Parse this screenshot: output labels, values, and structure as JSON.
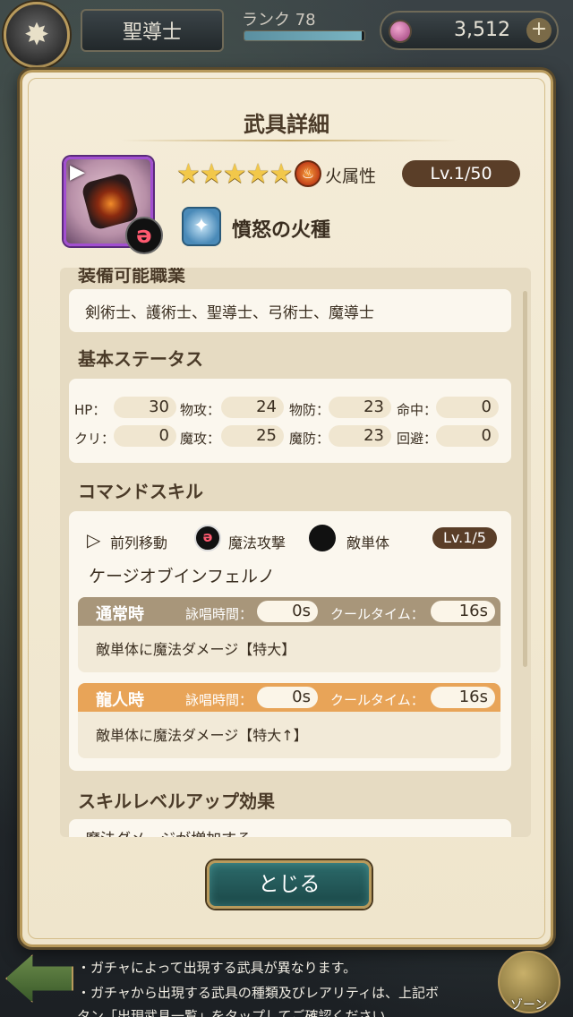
{
  "topbar": {
    "emblem_icon": "crossed-sword-emblem",
    "class_name": "聖導士",
    "rank_label": "ランク 78",
    "rank_progress": 0.98,
    "gem_count": "3,512",
    "plus_label": "+"
  },
  "modal": {
    "title": "武具詳細",
    "stars": "★★★★★",
    "element_glyph": "♨",
    "element_label": "火属性",
    "level": "Lv.1/50",
    "weapon_name": "憤怒の火種",
    "play_glyph": "▶",
    "magic_glyph": "ə"
  },
  "equip_jobs": {
    "section_title": "装備可能職業",
    "jobs": "剣術士、護術士、聖導士、弓術士、魔導士"
  },
  "base_status": {
    "section_title": "基本ステータス",
    "rows": [
      [
        {
          "label": "HP：",
          "value": "30"
        },
        {
          "label": "物攻：",
          "value": "24"
        },
        {
          "label": "物防：",
          "value": "23"
        },
        {
          "label": "命中：",
          "value": "0"
        }
      ],
      [
        {
          "label": "クリ：",
          "value": "0"
        },
        {
          "label": "魔攻：",
          "value": "25"
        },
        {
          "label": "魔防：",
          "value": "23"
        },
        {
          "label": "回避：",
          "value": "0"
        }
      ]
    ]
  },
  "command_skill": {
    "section_title": "コマンドスキル",
    "move_label": "前列移動",
    "attack_label": "魔法攻撃",
    "target_label": "敵単体",
    "level": "Lv.1/5",
    "skill_name": "ケージオブインフェルノ",
    "normal": {
      "title": "通常時",
      "cast_label": "詠唱時間：",
      "cast_value": "0s",
      "cooldown_label": "クールタイム：",
      "cooldown_value": "16s",
      "description": "敵単体に魔法ダメージ【特大】"
    },
    "dragon": {
      "title": "龍人時",
      "cast_label": "詠唱時間：",
      "cast_value": "0s",
      "cooldown_label": "クールタイム：",
      "cooldown_value": "16s",
      "description": "敵単体に魔法ダメージ【特大↑】"
    }
  },
  "skill_levelup": {
    "section_title": "スキルレベルアップ効果",
    "first_line": "魔法ダメージが増加する"
  },
  "close_label": "とじる",
  "footer": {
    "note1": "・ガチャによって出現する武具が異なります。",
    "note2": "・ガチャから出現する武具の種類及びレアリティは、上記ボ",
    "note3": "タン「出現武具一覧」をタップしてご確認ください。",
    "globe_label": "ゾーン"
  }
}
